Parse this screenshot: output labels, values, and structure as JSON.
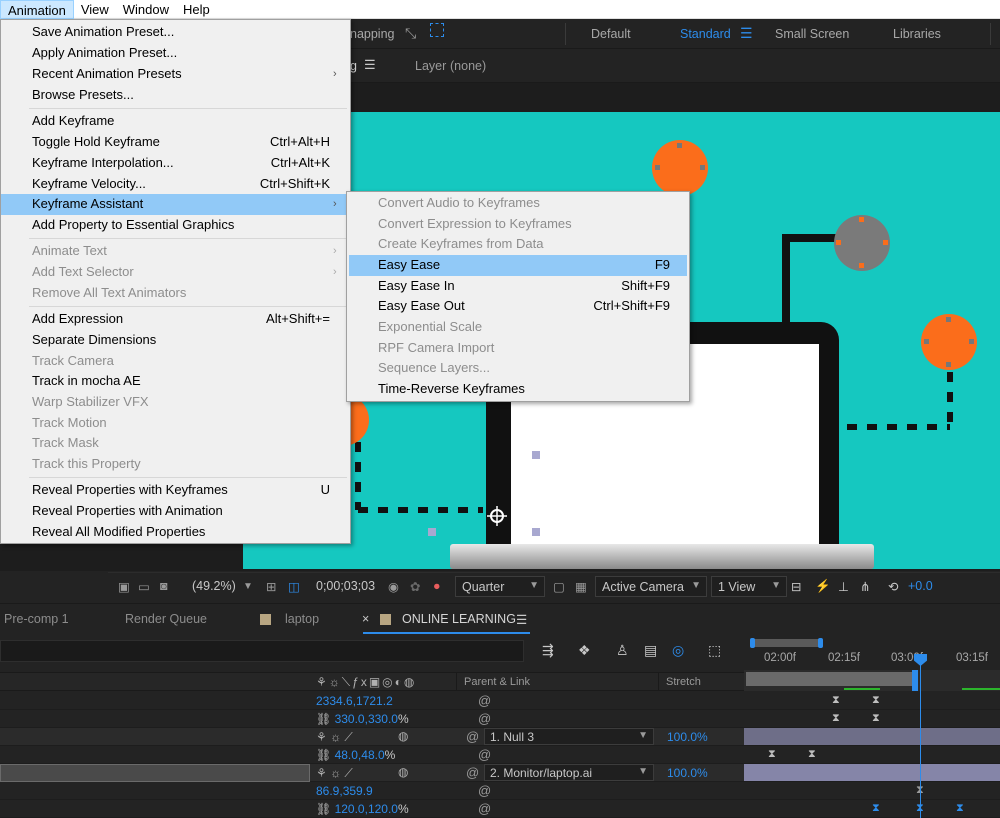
{
  "menubar": {
    "items": [
      {
        "label": "Animation",
        "active": true
      },
      {
        "label": "View"
      },
      {
        "label": "Window"
      },
      {
        "label": "Help"
      }
    ]
  },
  "toolbar": {
    "snapping_label": "napping",
    "workspaces": [
      "Default",
      "Standard",
      "Small Screen",
      "Libraries"
    ],
    "active_workspace": "Standard"
  },
  "panel_row": {
    "comp_tab_fragment": "g",
    "layer_label": "Layer",
    "layer_value": "(none)"
  },
  "animation_menu": {
    "items": [
      {
        "label": "Save Animation Preset..."
      },
      {
        "label": "Apply Animation Preset..."
      },
      {
        "label": "Recent Animation Presets",
        "submenu": true
      },
      {
        "label": "Browse Presets..."
      },
      {
        "label": "Add Keyframe"
      },
      {
        "label": "Toggle Hold Keyframe",
        "shortcut": "Ctrl+Alt+H"
      },
      {
        "label": "Keyframe Interpolation...",
        "shortcut": "Ctrl+Alt+K"
      },
      {
        "label": "Keyframe Velocity...",
        "shortcut": "Ctrl+Shift+K"
      },
      {
        "label": "Keyframe Assistant",
        "submenu": true,
        "highlighted": true
      },
      {
        "label": "Add Property to Essential Graphics"
      },
      {
        "label": "Animate Text",
        "submenu": true,
        "disabled": true
      },
      {
        "label": "Add Text Selector",
        "submenu": true,
        "disabled": true
      },
      {
        "label": "Remove All Text Animators",
        "disabled": true
      },
      {
        "label": "Add Expression",
        "shortcut": "Alt+Shift+="
      },
      {
        "label": "Separate Dimensions"
      },
      {
        "label": "Track Camera",
        "disabled": true
      },
      {
        "label": "Track in mocha AE"
      },
      {
        "label": "Warp Stabilizer VFX",
        "disabled": true
      },
      {
        "label": "Track Motion",
        "disabled": true
      },
      {
        "label": "Track Mask",
        "disabled": true
      },
      {
        "label": "Track this Property",
        "disabled": true
      },
      {
        "label": "Reveal Properties with Keyframes",
        "shortcut": "U"
      },
      {
        "label": "Reveal Properties with Animation"
      },
      {
        "label": "Reveal All Modified Properties"
      }
    ]
  },
  "keyframe_assistant_menu": {
    "items": [
      {
        "label": "Convert Audio to Keyframes",
        "disabled": true
      },
      {
        "label": "Convert Expression to Keyframes",
        "disabled": true
      },
      {
        "label": "Create Keyframes from Data",
        "disabled": true
      },
      {
        "label": "Easy Ease",
        "shortcut": "F9",
        "highlighted": true
      },
      {
        "label": "Easy Ease In",
        "shortcut": "Shift+F9"
      },
      {
        "label": "Easy Ease Out",
        "shortcut": "Ctrl+Shift+F9"
      },
      {
        "label": "Exponential Scale",
        "disabled": true
      },
      {
        "label": "RPF Camera Import",
        "disabled": true
      },
      {
        "label": "Sequence Layers...",
        "disabled": true
      },
      {
        "label": "Time-Reverse Keyframes"
      }
    ]
  },
  "viewer_footer": {
    "zoom": "(49.2%)",
    "timecode": "0;00;03;03",
    "resolution": "Quarter",
    "camera": "Active Camera",
    "views": "1 View",
    "exposure": "+0.0"
  },
  "panel_tabs": [
    {
      "label": "Pre-comp 1"
    },
    {
      "label": "Render Queue"
    },
    {
      "label": "laptop"
    },
    {
      "label": "ONLINE LEARNING",
      "active": true
    }
  ],
  "timeline": {
    "ruler_ticks": [
      "02:00f",
      "02:15f",
      "03:00f",
      "03:15f"
    ],
    "col_headers": {
      "parent": "Parent & Link",
      "stretch": "Stretch"
    },
    "rows": [
      {
        "value": "2334.6,1721.2",
        "type": "prop"
      },
      {
        "value": "330.0,330.0",
        "unit": "%",
        "type": "prop"
      },
      {
        "type": "layer",
        "parent": "1. Null 3",
        "stretch": "100.0%"
      },
      {
        "value": "48.0,48.0",
        "unit": "%",
        "type": "prop"
      },
      {
        "type": "layer",
        "parent": "2. Monitor/laptop.ai",
        "stretch": "100.0%",
        "selected": true
      },
      {
        "value": "86.9,359.9",
        "type": "prop"
      },
      {
        "value": "120.0,120.0",
        "unit": "%",
        "type": "prop"
      }
    ]
  },
  "colors": {
    "canvas_bg": "#15c8c0",
    "accent_blue": "#2d8ceb",
    "orange": "#fb6d1b",
    "menu_highlight": "#91c9f7"
  }
}
